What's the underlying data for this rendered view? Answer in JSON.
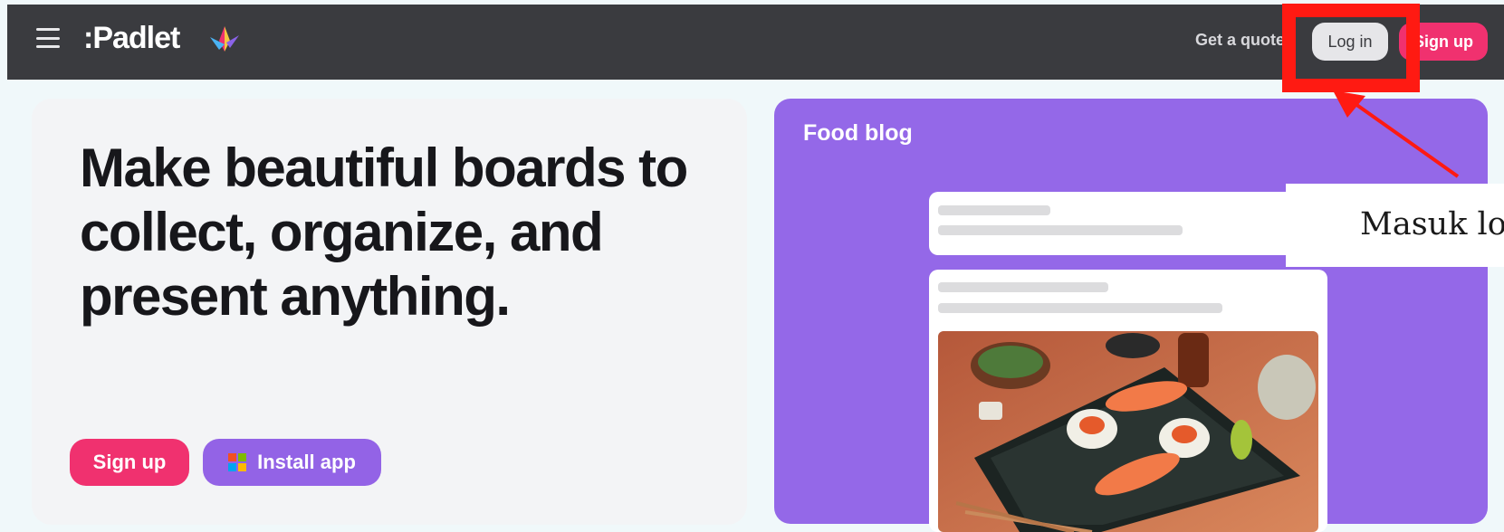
{
  "header": {
    "logo_text": ":Padlet",
    "get_quote_label": "Get a quote",
    "login_label": "Log in",
    "signup_label": "Sign up"
  },
  "hero": {
    "title": "Make beautiful boards to collect, organize, and present anything.",
    "signup_label": "Sign up",
    "install_label": "Install app"
  },
  "preview": {
    "board_title": "Food blog"
  },
  "annotation": {
    "caption": "Masuk login"
  },
  "colors": {
    "topbar": "#3a3b3f",
    "brand_pink": "#f0316f",
    "brand_purple": "#9468e8",
    "highlight_red": "#ff1a12"
  },
  "icons": [
    "menu-icon",
    "padlet-bird-icon",
    "windows-icon",
    "red-arrow-icon"
  ]
}
